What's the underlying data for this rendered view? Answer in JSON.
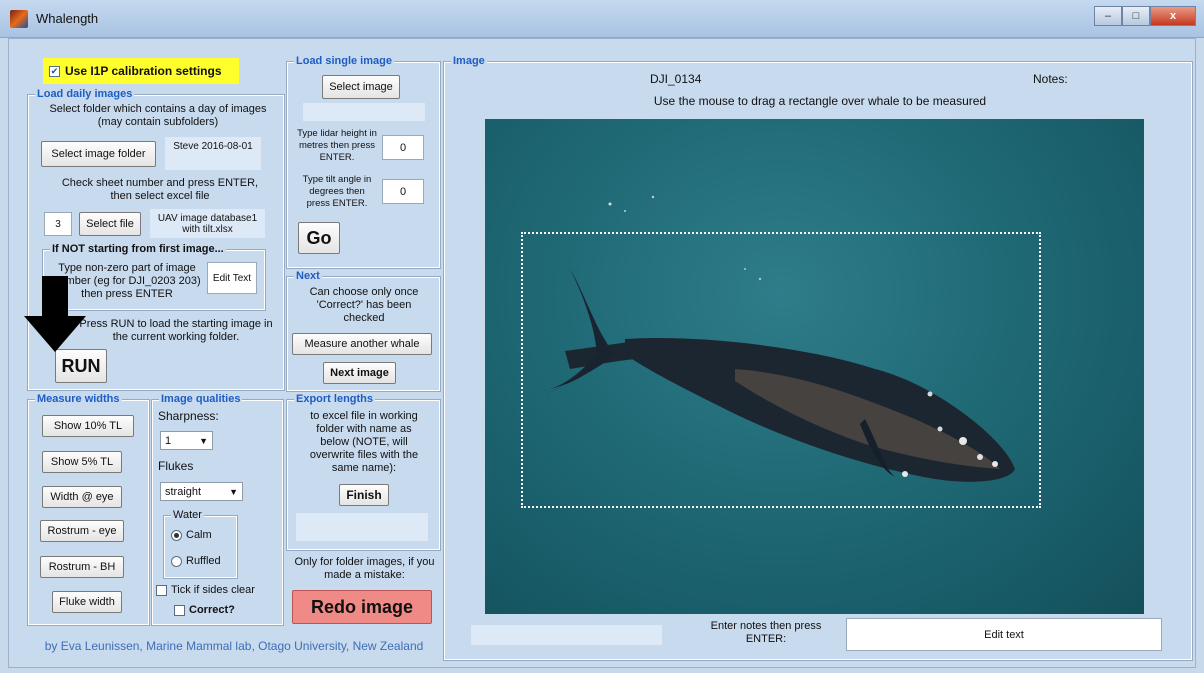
{
  "window": {
    "title": "Whalength",
    "minimize_label": "–",
    "maximize_label": "□",
    "close_label": "x"
  },
  "calibration": {
    "label": "Use I1P calibration settings",
    "checked": true
  },
  "load_daily": {
    "title": "Load daily images",
    "instructions": "Select folder which contains a day of images (may contain subfolders)",
    "select_folder_label": "Select image folder",
    "folder_value": "Steve 2016-08-01",
    "sheet_instructions": "Check sheet number and press ENTER, then select excel file",
    "sheet_number": "3",
    "select_file_label": "Select file",
    "file_value": "UAV image database1 with tilt.xlsx"
  },
  "not_first": {
    "title": "If NOT starting from first image...",
    "instructions": "Type non-zero part of image number (eg for DJI_0203 203) then press ENTER",
    "edit_label": "Edit Text"
  },
  "run": {
    "instructions": "Press RUN to load the starting image in the current working folder.",
    "label": "RUN"
  },
  "load_single": {
    "title": "Load single image",
    "select_label": "Select image",
    "lidar_label": "Type lidar height in metres then press ENTER.",
    "lidar_value": "0",
    "tilt_label": "Type tilt angle in degrees then press ENTER.",
    "tilt_value": "0",
    "go_label": "Go"
  },
  "next": {
    "title": "Next",
    "instructions": "Can choose only once 'Correct?' has been checked",
    "measure_another_label": "Measure another whale",
    "next_image_label": "Next image"
  },
  "measure_widths": {
    "title": "Measure widths",
    "buttons": [
      "Show 10% TL",
      "Show 5% TL",
      "Width @ eye",
      "Rostrum - eye",
      "Rostrum - BH",
      "Fluke width"
    ]
  },
  "image_qualities": {
    "title": "Image qualities",
    "sharpness_label": "Sharpness:",
    "sharpness_value": "1",
    "flukes_label": "Flukes",
    "flukes_value": "straight",
    "water_title": "Water",
    "water_options": [
      "Calm",
      "Ruffled"
    ],
    "water_selected": "Calm",
    "sides_clear_label": "Tick if sides clear",
    "correct_label": "Correct?"
  },
  "export": {
    "title": "Export lengths",
    "instructions": "to excel file in working folder with name as below (NOTE, will overwrite files with the same name):",
    "finish_label": "Finish",
    "filename_value": ""
  },
  "redo": {
    "instructions": "Only for folder images, if you made a mistake:",
    "label": "Redo image"
  },
  "credit": "by Eva Leunissen, Marine Mammal lab, Otago University, New Zealand",
  "image_panel": {
    "title": "Image",
    "filename": "DJI_0134",
    "notes_label": "Notes:",
    "instructions": "Use the mouse to drag a rectangle over whale to be measured",
    "notes_prompt": "Enter notes then press ENTER:",
    "notes_edit_label": "Edit text"
  }
}
